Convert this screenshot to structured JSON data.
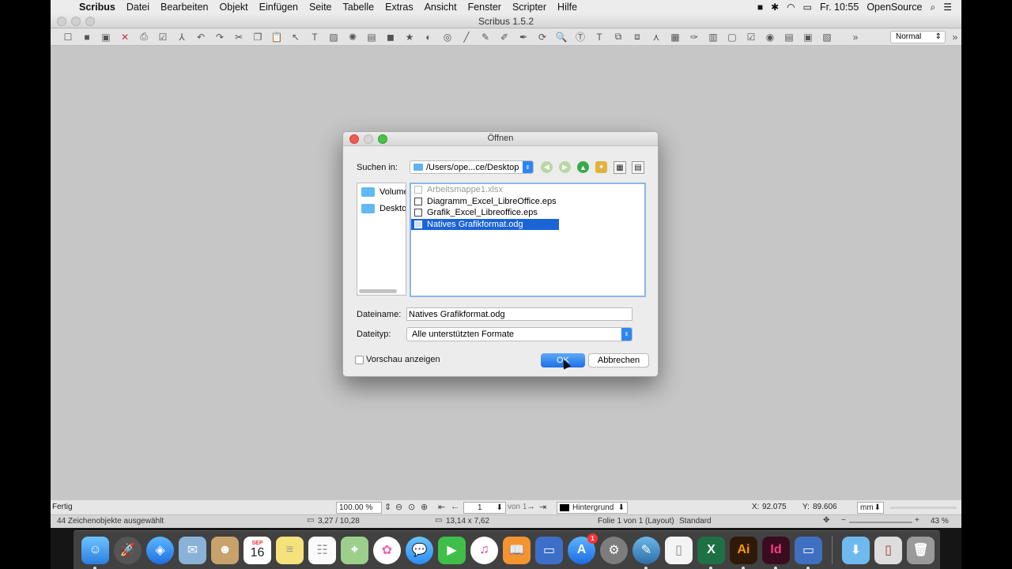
{
  "menubar": {
    "apple": "",
    "app": "Scribus",
    "items": [
      "Datei",
      "Bearbeiten",
      "Objekt",
      "Einfügen",
      "Seite",
      "Tabelle",
      "Extras",
      "Ansicht",
      "Fenster",
      "Scripter",
      "Hilfe"
    ],
    "clock": "Fr. 10:55",
    "user": "OpenSource"
  },
  "window": {
    "title": "Scribus 1.5.2",
    "zoom_mode": "Normal"
  },
  "dialog": {
    "title": "Öffnen",
    "lookin_label": "Suchen in:",
    "path": "/Users/ope...ce/Desktop",
    "sidebar": [
      "Volume",
      "Deskto"
    ],
    "files": [
      {
        "name": "Arbeitsmappe1.xlsx",
        "state": "dim"
      },
      {
        "name": "Diagramm_Excel_LibreOffice.eps",
        "state": "normal"
      },
      {
        "name": "Grafik_Excel_Libreoffice.eps",
        "state": "normal"
      },
      {
        "name": "Natives Grafikformat.odg",
        "state": "selected"
      }
    ],
    "filename_label": "Dateiname:",
    "filename_value": "Natives Grafikformat.odg",
    "filetype_label": "Dateityp:",
    "filetype_value": "Alle unterstützten Formate",
    "preview_label": "Vorschau anzeigen",
    "ok": "OK",
    "cancel": "Abbrechen"
  },
  "status": {
    "ready": "Fertig",
    "zoom": "100.00 %",
    "page": "1",
    "of": "von 1",
    "layer": "Hintergrund",
    "x_label": "X:",
    "x_value": "92.075",
    "y_label": "Y:",
    "y_value": "89.606",
    "unit": "mm",
    "objects": "44 Zeichenobjekte ausgewählt",
    "pos": "3,27 / 10,28",
    "size": "13,14 x 7,62",
    "folie": "Folie 1 von 1 (Layout)",
    "standard": "Standard",
    "zoom_pct": "43 %"
  },
  "dock": {
    "apps": [
      "finder",
      "launchpad",
      "safari",
      "mail",
      "contacts",
      "calendar",
      "notes",
      "reminders",
      "maps",
      "photos",
      "messages",
      "facetime",
      "itunes",
      "ibooks",
      "keynote",
      "app-store",
      "system-prefs",
      "scribus",
      "pages",
      "excel",
      "illustrator",
      "indesign",
      "keynote2",
      "downloads",
      "preview",
      "trash"
    ],
    "calendar_day": "16",
    "calendar_month": "SEP",
    "appstore_badge": "1",
    "ai_label": "Ai",
    "id_label": "Id",
    "x_label": "X"
  }
}
